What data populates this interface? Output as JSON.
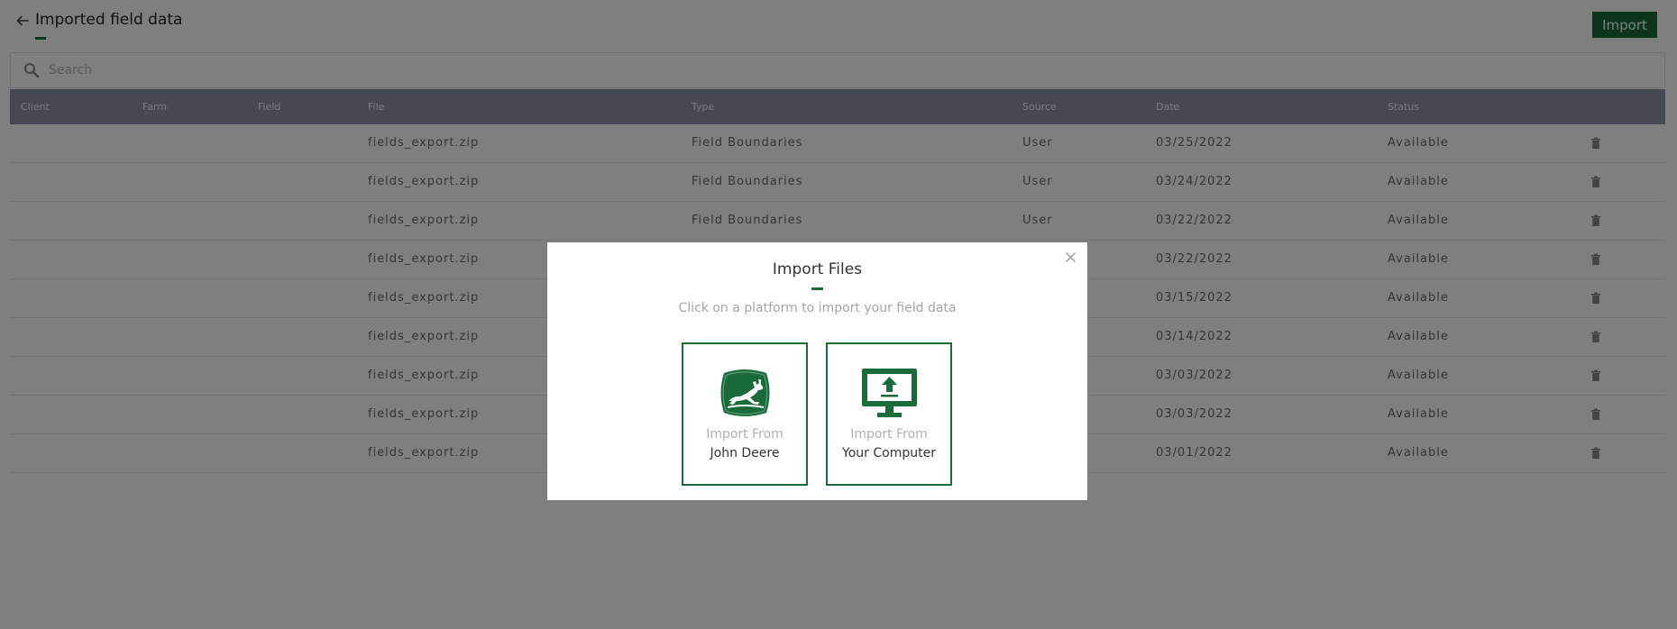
{
  "header": {
    "title": "Imported field data",
    "import_label": "Import"
  },
  "search": {
    "placeholder": "Search",
    "value": ""
  },
  "table": {
    "columns": [
      "Client",
      "Farm",
      "Field",
      "File",
      "Type",
      "Source",
      "Date",
      "Status"
    ],
    "rows": [
      {
        "client": "",
        "farm": "",
        "field": "",
        "file": "fields_export.zip",
        "type": "Field Boundaries",
        "source": "User",
        "date": "03/25/2022",
        "status": "Available"
      },
      {
        "client": "",
        "farm": "",
        "field": "",
        "file": "fields_export.zip",
        "type": "Field Boundaries",
        "source": "User",
        "date": "03/24/2022",
        "status": "Available"
      },
      {
        "client": "",
        "farm": "",
        "field": "",
        "file": "fields_export.zip",
        "type": "Field Boundaries",
        "source": "User",
        "date": "03/22/2022",
        "status": "Available"
      },
      {
        "client": "",
        "farm": "",
        "field": "",
        "file": "fields_export.zip",
        "type": "",
        "source": "",
        "date": "03/22/2022",
        "status": "Available"
      },
      {
        "client": "",
        "farm": "",
        "field": "",
        "file": "fields_export.zip",
        "type": "",
        "source": "",
        "date": "03/15/2022",
        "status": "Available"
      },
      {
        "client": "",
        "farm": "",
        "field": "",
        "file": "fields_export.zip",
        "type": "",
        "source": "",
        "date": "03/14/2022",
        "status": "Available"
      },
      {
        "client": "",
        "farm": "",
        "field": "",
        "file": "fields_export.zip",
        "type": "",
        "source": "",
        "date": "03/03/2022",
        "status": "Available"
      },
      {
        "client": "",
        "farm": "",
        "field": "",
        "file": "fields_export.zip",
        "type": "",
        "source": "",
        "date": "03/03/2022",
        "status": "Available"
      },
      {
        "client": "",
        "farm": "",
        "field": "",
        "file": "fields_export.zip",
        "type": "",
        "source": "",
        "date": "03/01/2022",
        "status": "Available"
      }
    ]
  },
  "modal": {
    "title": "Import Files",
    "subtitle": "Click on a platform to import your field data",
    "cards": [
      {
        "line1": "Import From",
        "line2": "John Deere",
        "icon": "john-deere-logo-icon"
      },
      {
        "line1": "Import From",
        "line2": "Your Computer",
        "icon": "computer-upload-icon"
      }
    ]
  },
  "colors": {
    "accent": "#1a6b3a",
    "table_header": "#8d93a3",
    "overlay": "rgba(0,0,0,0.5)"
  }
}
